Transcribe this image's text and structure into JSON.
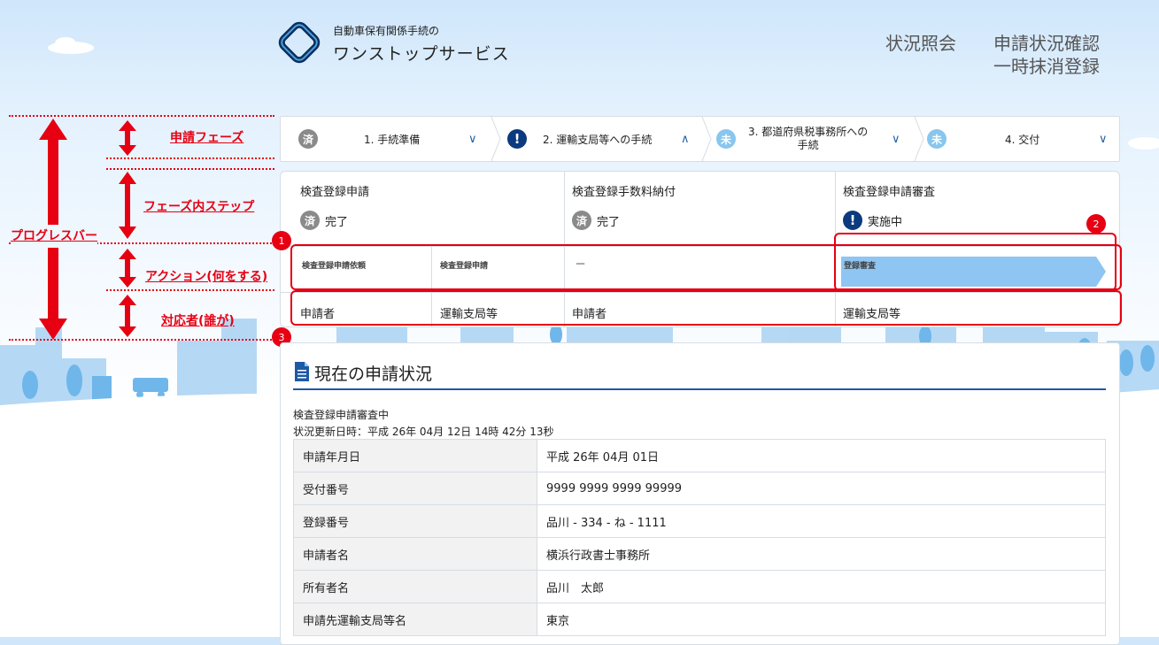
{
  "header": {
    "brand_small": "自動車保有関係手続の",
    "brand_big": "ワンストップサービス",
    "nav": [
      {
        "label": "状況照会"
      },
      {
        "label": "申請状況確認"
      },
      {
        "label": "一時抹消登録"
      }
    ]
  },
  "phases": [
    {
      "badge": "済",
      "label": "1. 手続準備",
      "state": "done"
    },
    {
      "badge": "!",
      "label": "2. 運輸支局等への手続",
      "state": "current"
    },
    {
      "badge": "未",
      "label": "3. 都道府県税事務所への",
      "label2": "手続",
      "state": "todo"
    },
    {
      "badge": "未",
      "label": "4. 交付",
      "state": "todo"
    }
  ],
  "steps": [
    {
      "title": "検査登録申請",
      "badge": "済",
      "status": "完了"
    },
    {
      "title": "検査登録手数料納付",
      "badge": "済",
      "status": "完了"
    },
    {
      "title": "検査登録申請審査",
      "badge": "!",
      "status": "実施中"
    }
  ],
  "actions": {
    "a1": "検査登録申請依頼",
    "a2": "検査登録申請",
    "a3": "－",
    "a4": "登録審査"
  },
  "actors": {
    "r1": "申請者",
    "r2": "運輸支局等",
    "r3": "申請者",
    "r4": "運輸支局等"
  },
  "callouts": [
    "1",
    "2",
    "3"
  ],
  "annotations": {
    "progress_bar": "プログレスバー",
    "phase": "申請フェーズ",
    "step": "フェーズ内ステップ",
    "action": "アクション(何をする)",
    "actor": "対応者(誰が)"
  },
  "status": {
    "title": "現在の申請状況",
    "current": "検査登録申請審査中",
    "updated": "状況更新日時：平成 26年 04月 12日 14時 42分 13秒",
    "rows": [
      {
        "key": "申請年月日",
        "value": "平成 26年 04月 01日"
      },
      {
        "key": "受付番号",
        "value": "9999 9999 9999 99999"
      },
      {
        "key": "登録番号",
        "value": "品川 - 334 - ね - 1111"
      },
      {
        "key": "申請者名",
        "value": "横浜行政書士事務所"
      },
      {
        "key": "所有者名",
        "value": "品川　太郎"
      },
      {
        "key": "申請先運輸支局等名",
        "value": "東京"
      }
    ]
  },
  "colors": {
    "accent": "#1d5aa5",
    "annotation": "#e60012",
    "done": "#8a8a8a",
    "todo": "#88c6ee",
    "current": "#0b3a7e",
    "action_bar": "#8ec5f3"
  }
}
